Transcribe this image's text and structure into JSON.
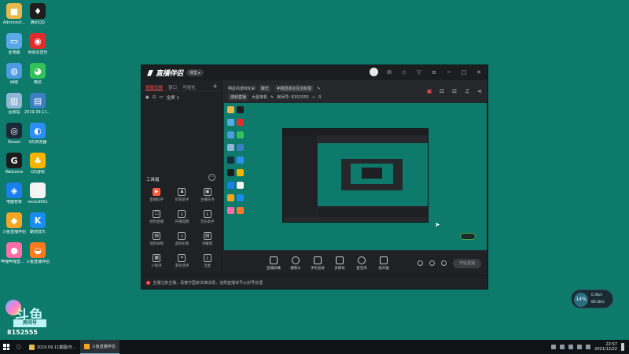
{
  "desktop": {
    "icons": [
      {
        "label": "Administr...",
        "color": "#e8b84a",
        "glyph": "■"
      },
      {
        "label": "腾讯QQ",
        "color": "#1e1e1e",
        "glyph": "♦"
      },
      {
        "label": "此电脑",
        "color": "#5aa8e6",
        "glyph": "▭"
      },
      {
        "label": "网易云音乐",
        "color": "#e22c2c",
        "glyph": "◉"
      },
      {
        "label": "网络",
        "color": "#4d9be0",
        "glyph": "◍"
      },
      {
        "label": "微信",
        "color": "#32c25a",
        "glyph": "◕"
      },
      {
        "label": "回收站",
        "color": "#8fb6d6",
        "glyph": "▥"
      },
      {
        "label": "2019.09.11 截图",
        "color": "#3b7ec4",
        "glyph": "▤"
      },
      {
        "label": "Steam",
        "color": "#1b2838",
        "glyph": "◎"
      },
      {
        "label": "QQ浏览器",
        "color": "#2c8ef5",
        "glyph": "◐"
      },
      {
        "label": "WeGame",
        "color": "#1b1b1b",
        "glyph": "G"
      },
      {
        "label": "QQ游戏",
        "color": "#f4b400",
        "glyph": "♣"
      },
      {
        "label": "电脑管家",
        "color": "#1c7ff0",
        "glyph": "◈"
      },
      {
        "label": "record001",
        "color": "#f2f2f2",
        "glyph": "♫"
      },
      {
        "label": "斗鱼直播伴侣",
        "color": "#f6a623",
        "glyph": "◆"
      },
      {
        "label": "酷狗音乐",
        "color": "#1a8cf0",
        "glyph": "K"
      },
      {
        "label": "哔哩哔哩直播姬",
        "color": "#ff6fa6",
        "glyph": "●"
      },
      {
        "label": "斗鱼直播伴侣",
        "color": "#ff7a1f",
        "glyph": "◒"
      }
    ]
  },
  "window": {
    "app_name": "直播伴侣",
    "version_badge": "课堂 ▸",
    "scene_tabs": [
      "场景切换",
      "窗口",
      "可视化"
    ],
    "add_label": "+",
    "scene_name": "全屏 1",
    "info": {
      "room_title": "明星的游戏化彩",
      "chip1": "聊天",
      "chip2": "#组团适合互动标签",
      "category": "游戏直播",
      "sub_category": "大型单机",
      "room_info": "房间号: 8152555",
      "count": "0"
    },
    "tool_section_title": "工具箱",
    "tools": [
      {
        "label": "直播助手",
        "glyph": "▶",
        "hot": true
      },
      {
        "label": "房管助手",
        "glyph": "♟",
        "hot": false
      },
      {
        "label": "主播任务",
        "glyph": "▣",
        "hot": false
      },
      {
        "label": "视频直播",
        "glyph": "☐",
        "hot": false
      },
      {
        "label": "开播提醒",
        "glyph": "⤓",
        "hot": false
      },
      {
        "label": "音乐助手",
        "glyph": "⤓",
        "hot": false
      },
      {
        "label": "视频录制",
        "glyph": "▤",
        "hot": false
      },
      {
        "label": "虚拟形象",
        "glyph": "⤓",
        "hot": false
      },
      {
        "label": "弹幕库",
        "glyph": "▤",
        "hot": false
      },
      {
        "label": "小程序",
        "glyph": "▦",
        "hot": false
      },
      {
        "label": "游戏测评",
        "glyph": "⌗",
        "hot": false
      },
      {
        "label": "连麦",
        "glyph": "⤓",
        "hot": false
      }
    ],
    "controls": [
      "直播屏幕",
      "摄像头",
      "手机投屏",
      "多媒体",
      "麦克风",
      "扬声器"
    ],
    "live_button": "开始直播",
    "notice": "主播注意主播，请遵守国家法律法规，违规直播将予以封号处理"
  },
  "overlay": {
    "big_text": "斗鱼",
    "tag": "房间号",
    "room_number": "8152555"
  },
  "network": {
    "percent": "14%",
    "up": "0.3K/s",
    "down": "80.5K/s"
  },
  "taskbar": {
    "items": [
      {
        "label": "2019.09.11截图/日...",
        "color": "#e8b84a",
        "active": false
      },
      {
        "label": "斗鱼直播伴侣",
        "color": "#f6a623",
        "active": true
      }
    ],
    "time": "22:57",
    "date": "2021/12/22"
  }
}
